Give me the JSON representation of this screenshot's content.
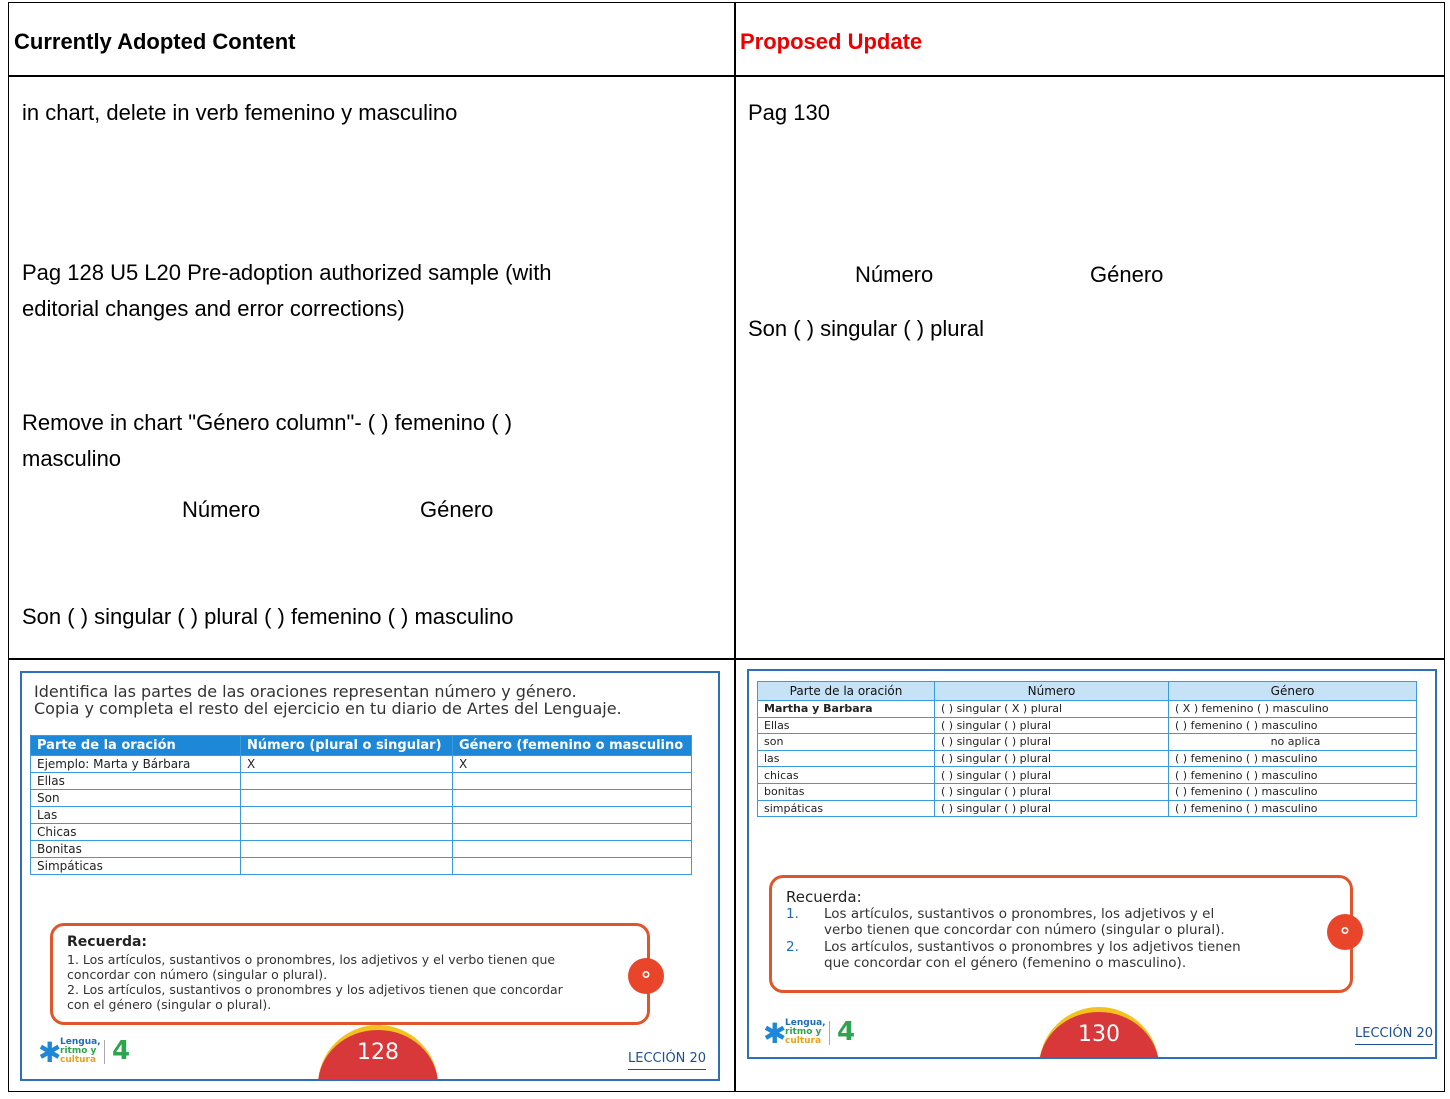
{
  "headers": {
    "left": "Currently Adopted Content",
    "right": "Proposed Update"
  },
  "left_text": {
    "line1": "in chart, delete in verb femenino y masculino",
    "line2a": "Pag 128 U5 L20 Pre-adoption authorized sample (with",
    "line2b": "editorial changes and error corrections)",
    "line3a": "Remove in chart \"Género column\"- ( ) femenino ( )",
    "line3b": "masculino",
    "numero": "Número",
    "genero": "Género",
    "son_line": "Son ( ) singular ( ) plural ( ) femenino ( ) masculino"
  },
  "right_text": {
    "pag": "Pag 130",
    "numero": "Número",
    "genero": "Género",
    "son_line": "Son  ( ) singular ( ) plural"
  },
  "page128": {
    "instruction1": "Identifica las partes de las oraciones representan número y género.",
    "instruction2": "Copia y completa el resto del ejercicio en tu diario de Artes del Lenguaje.",
    "columns": [
      "Parte de la oración",
      "Número (plural o singular)",
      "Género (femenino o masculino"
    ],
    "rows": [
      [
        "Ejemplo: Marta y Bárbara",
        "X",
        "X"
      ],
      [
        "Ellas",
        "",
        ""
      ],
      [
        "Son",
        "",
        ""
      ],
      [
        "Las",
        "",
        ""
      ],
      [
        "Chicas",
        "",
        ""
      ],
      [
        "Bonitas",
        "",
        ""
      ],
      [
        "Simpáticas",
        "",
        ""
      ]
    ],
    "recuerda_title": "Recuerda:",
    "recuerda_lines": [
      "1. Los artículos, sustantivos o pronombres, los adjetivos y el verbo tienen que",
      "    concordar con número (singular o plural).",
      "2. Los artículos, sustantivos o pronombres y los adjetivos tienen que concordar",
      "    con el género (singular o plural)."
    ],
    "logo_words": [
      "Lengua,",
      "ritmo y",
      "cultura"
    ],
    "grade": "4",
    "page_number": "128",
    "leccion": "LECCIÓN 20"
  },
  "page130": {
    "columns": [
      "Parte de la oración",
      "Número",
      "Género"
    ],
    "rows": [
      [
        "Martha y Barbara",
        "(   ) singular      ( X ) plural",
        "( X ) femenino   (   ) masculino"
      ],
      [
        "Ellas",
        "(   ) singular      (   ) plural",
        "(   ) femenino   (   ) masculino"
      ],
      [
        "son",
        "(   ) singular      (   ) plural",
        "no aplica"
      ],
      [
        "las",
        "(   ) singular      (   ) plural",
        "(   ) femenino   (   ) masculino"
      ],
      [
        "chicas",
        "(   ) singular      (   ) plural",
        "(   ) femenino   (   ) masculino"
      ],
      [
        "bonitas",
        "(   ) singular      (   ) plural",
        "(   ) femenino   (   ) masculino"
      ],
      [
        "simpáticas",
        "(   ) singular      (   ) plural",
        "(   ) femenino   (   ) masculino"
      ]
    ],
    "recuerda_title": "Recuerda:",
    "recuerda_items": [
      {
        "num": "1.",
        "a": "Los artículos, sustantivos o pronombres, los adjetivos y el",
        "b": "verbo tienen que concordar con número (singular o plural)."
      },
      {
        "num": "2.",
        "a": "Los artículos, sustantivos o pronombres y los adjetivos tienen",
        "b": "que concordar con el género (femenino o masculino)."
      }
    ],
    "logo_words": [
      "Lengua,",
      "ritmo y",
      "cultura"
    ],
    "grade": "4",
    "page_number": "130",
    "leccion": "LECCIÓN 20"
  }
}
